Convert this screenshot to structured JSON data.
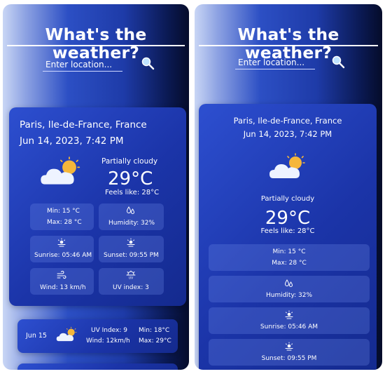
{
  "app": {
    "title": "What's the weather?"
  },
  "search": {
    "placeholder": "Enter location..."
  },
  "current": {
    "location": "Paris, Ile-de-France, France",
    "datetime": "Jun 14, 2023, 7:42 PM",
    "condition": "Partially cloudy",
    "temperature": "29°C",
    "feels_like": "Feels like: 28°C",
    "min": "Min: 15 °C",
    "max": "Max: 28 °C",
    "humidity": "Humidity: 32%",
    "sunrise": "Sunrise: 05:46 AM",
    "sunset": "Sunset: 09:55 PM",
    "wind": "Wind: 13 km/h",
    "uv": "UV index: 3"
  },
  "forecast": [
    {
      "date": "Jun 15",
      "uv": "UV Index: 9",
      "wind": "Wind: 12km/h",
      "min": "Min: 18°C",
      "max": "Max: 29°C"
    }
  ],
  "icons": {
    "weather": "partly-cloudy-icon",
    "search": "magnifier-icon",
    "humidity": "water-drop-icon",
    "sunrise": "sunrise-icon",
    "sunset": "sunset-icon",
    "wind": "wind-icon",
    "uv": "uv-icon"
  },
  "colors": {
    "card": "#1b34a8",
    "sub_card": "#4a66d6",
    "sun": "#f5b63a",
    "cloud": "#e8efff"
  }
}
